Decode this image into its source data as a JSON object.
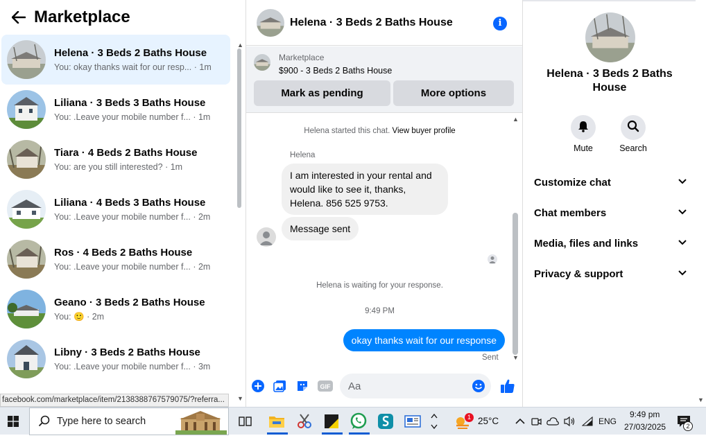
{
  "left": {
    "title": "Marketplace",
    "conversations": [
      {
        "title": "Helena · 3 Beds 2 Baths House",
        "preview": "You: okay thanks wait for our resp...",
        "time": "1m",
        "active": true
      },
      {
        "title": "Liliana · 3 Beds 3 Baths House",
        "preview": "You: .Leave your mobile number f...",
        "time": "1m"
      },
      {
        "title": "Tiara · 4 Beds 2 Baths House",
        "preview": "You: are you still interested?",
        "time": "1m"
      },
      {
        "title": "Liliana · 4 Beds 3 Baths House",
        "preview": "You: .Leave your mobile number f...",
        "time": "2m"
      },
      {
        "title": "Ros · 4 Beds 2 Baths House",
        "preview": "You: .Leave your mobile number f...",
        "time": "2m"
      },
      {
        "title": "Geano · 3 Beds 2 Baths House",
        "preview": "You: 🙂",
        "time": "2m"
      },
      {
        "title": "Libny · 3 Beds 2 Baths House",
        "preview": "You: .Leave your mobile number f...",
        "time": "3m"
      }
    ],
    "status_url": "facebook.com/marketplace/item/2138388767579075/?referra..."
  },
  "chat": {
    "header_title": "Helena · 3 Beds 2 Baths House",
    "listing_label": "Marketplace",
    "listing_price": "$900 - 3 Beds 2 Baths House",
    "mark_pending": "Mark as pending",
    "more_options": "More options",
    "started_text": "Helena started this chat.",
    "view_profile": "View buyer profile",
    "sender_name": "Helena",
    "msg1": "I am interested in your rental and would like to see it, thanks, Helena. 856 525 9753.",
    "msg2": "Message sent",
    "waiting_text": "Helena is waiting for your response.",
    "time_stamp": "9:49 PM",
    "msg_out": "okay thanks wait for our response",
    "sent_label": "Sent",
    "composer_placeholder": "Aa"
  },
  "right": {
    "name": "Helena · 3 Beds 2 Baths House",
    "mute_label": "Mute",
    "search_label": "Search",
    "sections": [
      "Customize chat",
      "Chat members",
      "Media, files and links",
      "Privacy & support"
    ]
  },
  "taskbar": {
    "search_placeholder": "Type here to search",
    "temperature": "25°C",
    "weather_badge": "1",
    "language": "ENG",
    "time": "9:49 pm",
    "date": "27/03/2025",
    "notification_count": "2"
  },
  "colors": {
    "accent": "#0866ff",
    "outgoing_bubble": "#0084ff",
    "active_conversation": "#e7f3ff"
  }
}
